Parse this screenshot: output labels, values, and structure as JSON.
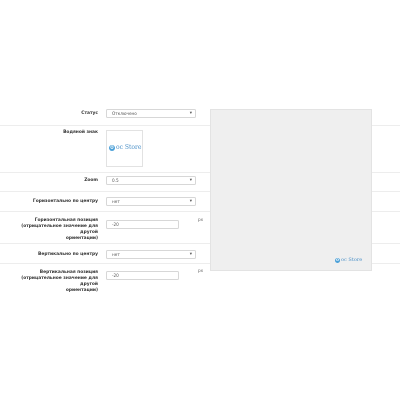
{
  "form": {
    "status": {
      "label": "Статус",
      "value": "Отключено"
    },
    "watermark": {
      "label": "Водяной знак"
    },
    "zoom": {
      "label": "Zoom",
      "value": "0.5"
    },
    "horizontal_center": {
      "label": "Горизонтально по центру",
      "value": "нет"
    },
    "horizontal_position": {
      "label_lines": [
        "Горизонтальная позиция",
        "(отрицательное значение для другой",
        "ориентации)"
      ],
      "value": "-20",
      "unit": "px"
    },
    "vertical_center": {
      "label": "Вертикально по центру",
      "value": "нет"
    },
    "vertical_position": {
      "label_lines": [
        "Вертикальная позиция",
        "(отрицательное значение для другой",
        "ориентации)"
      ],
      "value": "-20",
      "unit": "px"
    }
  },
  "logo": {
    "mark": "O",
    "text": "oc Store"
  },
  "icons": {
    "select_caret": "chevron-down-icon"
  },
  "colors": {
    "accent": "#4a90c8",
    "preview_bg": "#efefef",
    "border": "#d7d7d7"
  }
}
